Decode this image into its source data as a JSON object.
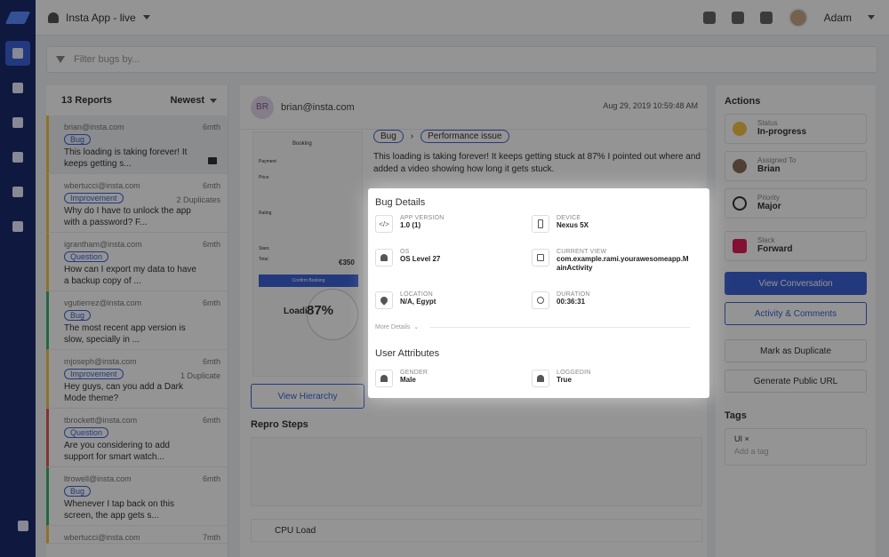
{
  "header": {
    "app_name": "Insta App - live",
    "user_name": "Adam"
  },
  "filter": {
    "placeholder": "Filter bugs by..."
  },
  "list": {
    "count_label": "13 Reports",
    "sort_label": "Newest",
    "reports": [
      {
        "email": "brian@insta.com",
        "age": "6mth",
        "tag": "Bug",
        "message": "This loading is taking forever! It keeps getting s..."
      },
      {
        "email": "wbertucci@insta.com",
        "age": "6mth",
        "duplicates": "2 Duplicates",
        "tag": "Improvement",
        "message": "Why do I have to unlock the app with a password? F..."
      },
      {
        "email": "igrantham@insta.com",
        "age": "6mth",
        "tag": "Question",
        "message": "How can I export my data to have a backup copy of ..."
      },
      {
        "email": "vgutierrez@insta.com",
        "age": "6mth",
        "tag": "Bug",
        "message": "The most recent app version is slow, specially in ..."
      },
      {
        "email": "mjoseph@insta.com",
        "age": "6mth",
        "duplicates": "1 Duplicate",
        "tag": "Improvement",
        "message": "Hey guys, can you add a Dark Mode theme?"
      },
      {
        "email": "tbrockett@insta.com",
        "age": "6mth",
        "tag": "Question",
        "message": "Are you considering to add support for smart watch..."
      },
      {
        "email": "ltrowell@insta.com",
        "age": "6mth",
        "tag": "Bug",
        "message": "Whenever I tap back on this screen, the app gets s..."
      },
      {
        "email": "wbertucci@insta.com",
        "age": "7mth"
      }
    ]
  },
  "detail": {
    "avatar_initials": "BR",
    "reporter": "brian@insta.com",
    "date": "Aug 29, 2019 10:59:48 AM",
    "tag": "Bug",
    "category": "Performance issue",
    "description": "This loading is taking forever! It keeps getting stuck at 87% I pointed out where and added a video showing how long it gets stuck.",
    "view_hierarchy": "View Hierarchy",
    "repro_title": "Repro Steps",
    "cpu_label": "CPU Load",
    "screenshot_text": {
      "booking": "Booking",
      "payment": "Payment",
      "price": "Price",
      "rating": "Rating",
      "stars": "Stars",
      "total": "Total",
      "amount": "€350",
      "confirm": "Confirm Booking",
      "loading": "Loadi",
      "percent": "87%"
    }
  },
  "bug_details": {
    "title": "Bug Details",
    "app_version": {
      "label": "APP VERSION",
      "value": "1.0 (1)"
    },
    "device": {
      "label": "DEVICE",
      "value": "Nexus 5X"
    },
    "os": {
      "label": "OS",
      "value": "OS Level 27"
    },
    "current_view": {
      "label": "CURRENT VIEW",
      "value": "com.example.rami.yourawesomeapp.MainActivity"
    },
    "location": {
      "label": "LOCATION",
      "value": "N/A, Egypt"
    },
    "duration": {
      "label": "DURATION",
      "value": "00:36:31"
    },
    "more_details": "More Details"
  },
  "user_attributes": {
    "title": "User Attributes",
    "gender": {
      "label": "GENDER",
      "value": "Male"
    },
    "loggedin": {
      "label": "LOGGEDIN",
      "value": "True"
    }
  },
  "actions": {
    "title": "Actions",
    "status": {
      "label": "Status",
      "value": "In-progress"
    },
    "assigned": {
      "label": "Assigned To",
      "value": "Brian"
    },
    "priority": {
      "label": "Priority",
      "value": "Major"
    },
    "slack": {
      "label": "Slack",
      "value": "Forward"
    },
    "view_conversation": "View Conversation",
    "activity": "Activity & Comments",
    "mark_duplicate": "Mark as Duplicate",
    "public_url": "Generate Public URL",
    "tags_title": "Tags",
    "tag_ui": "UI",
    "add_tag": "Add a tag"
  },
  "colors": {
    "nav": "#1b2a6b",
    "accent": "#3d63d9",
    "status_yellow": "#f5c544"
  }
}
